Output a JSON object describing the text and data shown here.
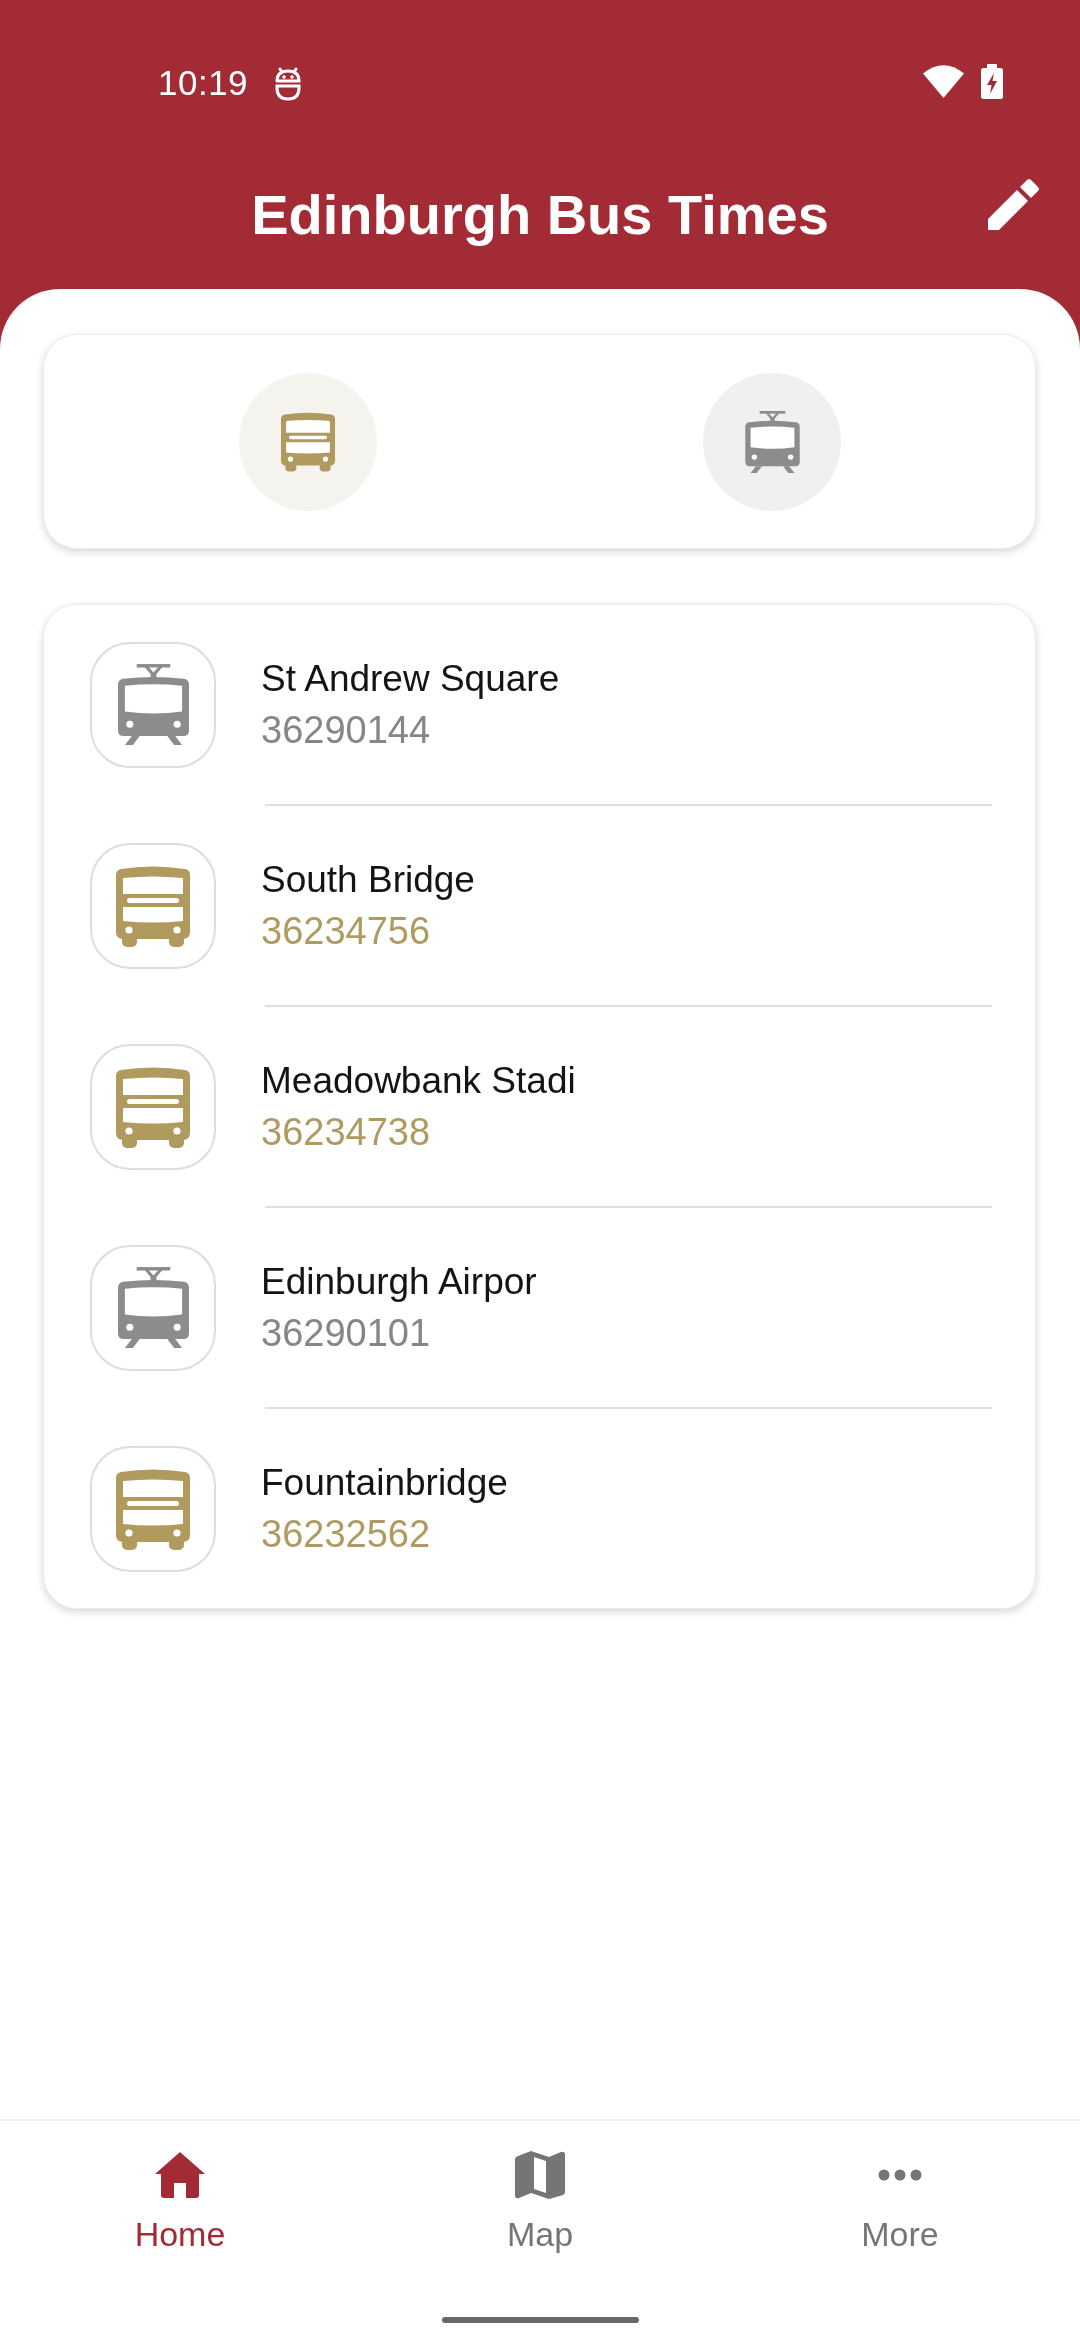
{
  "status_bar": {
    "time": "10:19"
  },
  "app_bar": {
    "title": "Edinburgh Bus Times"
  },
  "filters": [
    {
      "kind": "bus"
    },
    {
      "kind": "tram"
    }
  ],
  "stops": [
    {
      "kind": "tram",
      "name": "St Andrew Square",
      "code": "36290144"
    },
    {
      "kind": "bus",
      "name": "South Bridge",
      "code": "36234756"
    },
    {
      "kind": "bus",
      "name": "Meadowbank Stadi",
      "code": "36234738"
    },
    {
      "kind": "tram",
      "name": "Edinburgh Airpor",
      "code": "36290101"
    },
    {
      "kind": "bus",
      "name": "Fountainbridge",
      "code": "36232562"
    }
  ],
  "bottom_nav": [
    {
      "kind": "home",
      "label": "Home",
      "selected": true
    },
    {
      "kind": "map",
      "label": "Map",
      "selected": false
    },
    {
      "kind": "more",
      "label": "More",
      "selected": false
    }
  ]
}
